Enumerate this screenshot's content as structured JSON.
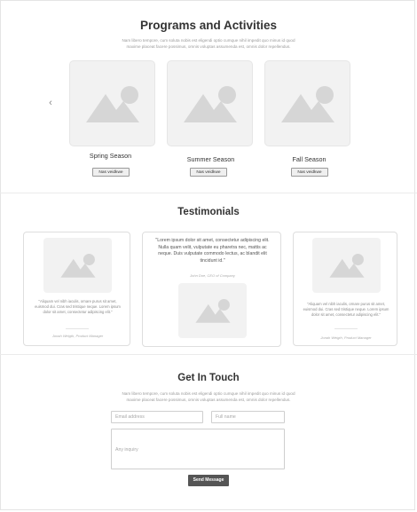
{
  "programs": {
    "title": "Programs and Activities",
    "subtitle": "Nam libero tempore, cum soluta nobis est eligendi optio cumque nihil impedit quo minus id quod maxime placeat facere possimus, omnis voluptas assumenda est, omnis dolor repellendus.",
    "prev_arrow": "‹",
    "cards": [
      {
        "label": "Spring Season",
        "button": "Nas veidkwe"
      },
      {
        "label": "Summer Season",
        "button": "Nas veidkwe"
      },
      {
        "label": "Fall Season",
        "button": "Nas veidkwe"
      }
    ]
  },
  "testimonials": {
    "title": "Testimonials",
    "left": {
      "quote": "\"Aliquam vel nibh iaculis, ornare purus sit amet, euismod dui. Cras sed tristique neque. Lorem ipsum dolor sit amet, consectetur adipiscing elit.\"",
      "author": "Jonah Weigth, Product Manager"
    },
    "center": {
      "quote": "\"Lorem ipsum dolor sit amet, consectetur adipiscing elit. Nulla quam velit, vulputate eu pharetra nec, mattis ac neque. Duis vulputate commodo lectus, ac blandit elit tincidunt id.\"",
      "author": "John Doe, CEO of Company"
    },
    "right": {
      "quote": "\"Aliquam vel nibh iaculis, ornare purus sit amet, euismod dui. Cras sed tristique neque. Lorem ipsum dolor sit amet, consectetur adipiscing elit.\"",
      "author": "Jonah Weigth, Product Manager"
    }
  },
  "contact": {
    "title": "Get In Touch",
    "subtitle": "Nam libero tempore, cum soluta nobis est eligendi optio cumque nihil impedit quo minus id quod maxime placeat facere possimus, omnis voluptas assumenda est, omnis dolor repellendus.",
    "email_placeholder": "Email address",
    "name_placeholder": "Full name",
    "inquiry_placeholder": "Any inquiry",
    "send_label": "Send Message"
  }
}
